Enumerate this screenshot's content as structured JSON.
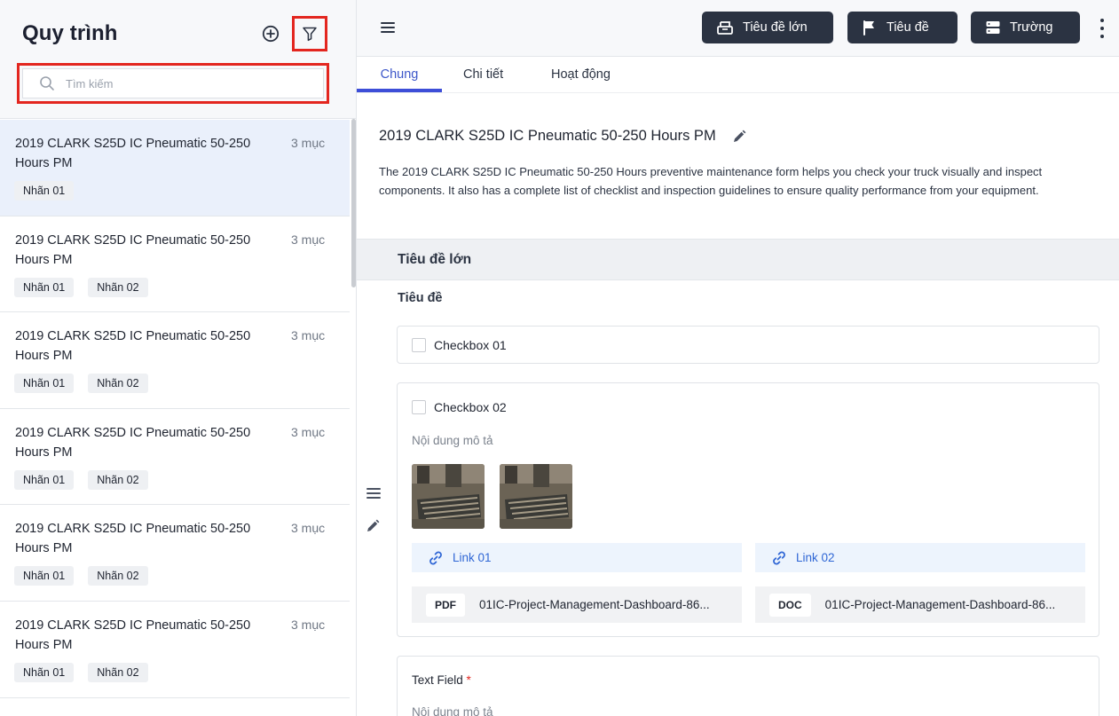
{
  "sidebar": {
    "title": "Quy trình",
    "search_placeholder": "Tìm kiếm",
    "items": [
      {
        "title": "2019 CLARK S25D IC Pneumatic 50-250 Hours PM",
        "count": "3 mục",
        "tags": [
          "Nhãn 01"
        ]
      },
      {
        "title": "2019 CLARK S25D IC Pneumatic 50-250 Hours PM",
        "count": "3 mục",
        "tags": [
          "Nhãn 01",
          "Nhãn 02"
        ]
      },
      {
        "title": "2019 CLARK S25D IC Pneumatic 50-250 Hours PM",
        "count": "3 mục",
        "tags": [
          "Nhãn 01",
          "Nhãn 02"
        ]
      },
      {
        "title": "2019 CLARK S25D IC Pneumatic 50-250 Hours PM",
        "count": "3 mục",
        "tags": [
          "Nhãn 01",
          "Nhãn 02"
        ]
      },
      {
        "title": "2019 CLARK S25D IC Pneumatic 50-250 Hours PM",
        "count": "3 mục",
        "tags": [
          "Nhãn 01",
          "Nhãn 02"
        ]
      },
      {
        "title": "2019 CLARK S25D IC Pneumatic 50-250 Hours PM",
        "count": "3 mục",
        "tags": [
          "Nhãn 01",
          "Nhãn 02"
        ]
      }
    ]
  },
  "toolbar": {
    "heading_button": "Tiêu đề lớn",
    "title_button": "Tiêu đề",
    "field_button": "Trường"
  },
  "tabs": [
    "Chung",
    "Chi tiết",
    "Hoạt động"
  ],
  "form": {
    "title": "2019 CLARK S25D IC Pneumatic 50-250 Hours PM",
    "description": "The 2019 CLARK S25D IC Pneumatic 50-250 Hours preventive maintenance form helps you check your truck visually and inspect components. It also has a complete list of checklist and inspection guidelines to ensure quality performance from your equipment.",
    "section_heading": "Tiêu đề lớn",
    "subheading": "Tiêu đề",
    "checkbox1": "Checkbox 01",
    "checkbox2": "Checkbox 02",
    "description_placeholder": "Nội dung mô tả",
    "links": [
      "Link 01",
      "Link 02"
    ],
    "files": [
      {
        "type": "PDF",
        "name": "01IC-Project-Management-Dashboard-86..."
      },
      {
        "type": "DOC",
        "name": "01IC-Project-Management-Dashboard-86..."
      }
    ],
    "text_field_label": "Text Field",
    "required_mark": "*",
    "text_field_description": "Nội dung mô tả"
  },
  "colors": {
    "accent": "#3d4ed8",
    "dark_button": "#2b3342",
    "highlight_box": "#e3261f",
    "link": "#2f66d5",
    "selected_row": "#eaf0fb"
  }
}
